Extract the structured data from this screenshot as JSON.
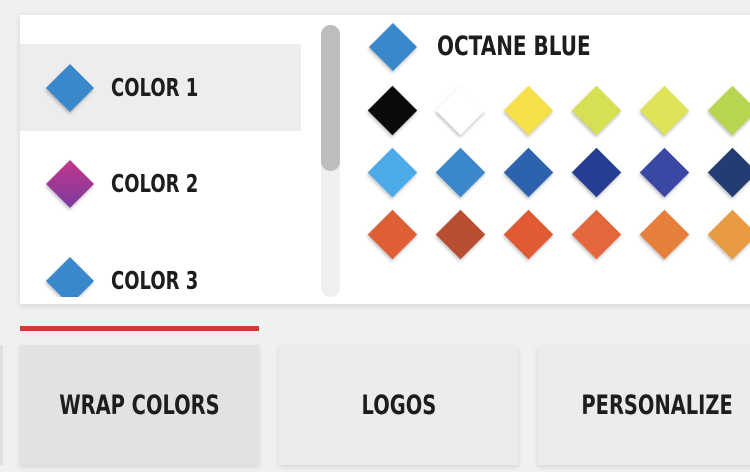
{
  "colors_panel": {
    "items": [
      {
        "label": "COLOR 1",
        "color": "#3a87cc",
        "selected": true
      },
      {
        "label": "COLOR 2",
        "color": "#b8358f",
        "gradient_to": "#7a3ba0",
        "selected": false
      },
      {
        "label": "COLOR 3",
        "color": "#3a87cc",
        "selected": false
      }
    ],
    "current": {
      "name": "OCTANE BLUE",
      "color": "#3a87cc"
    },
    "palette": [
      [
        "#0a0a0a",
        "#ffffff",
        "#f7e04a",
        "#d6e052",
        "#dde457",
        "#b9d652"
      ],
      [
        "#4aabe8",
        "#3a87cc",
        "#2d63ae",
        "#243e93",
        "#3a47a3",
        "#233c72"
      ],
      [
        "#df5f34",
        "#b94d32",
        "#e05a32",
        "#e3673a",
        "#e57f3a",
        "#e89b40"
      ]
    ]
  },
  "tabs": [
    {
      "label": "WRAP COLORS",
      "active": true
    },
    {
      "label": "LOGOS",
      "active": false
    },
    {
      "label": "PERSONALIZE",
      "active": false
    }
  ],
  "accent_color": "#d33838"
}
